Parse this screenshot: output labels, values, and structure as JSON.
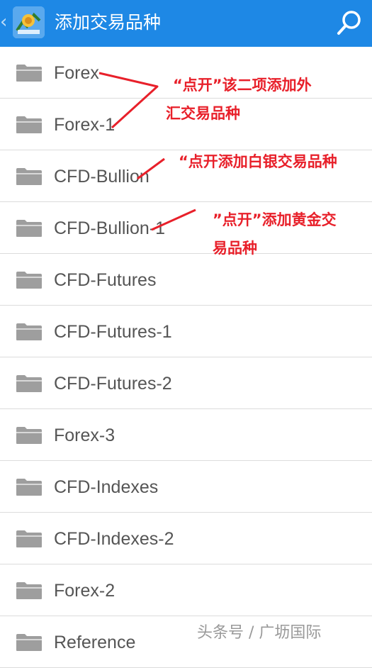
{
  "header": {
    "title": "添加交易品种",
    "back_icon": "chevron-left-icon",
    "app_icon": "metatrader-logo-icon",
    "search_icon": "search-icon",
    "background_color": "#1e88e5"
  },
  "list": {
    "folder_icon": "folder-icon",
    "items": [
      {
        "label": "Forex"
      },
      {
        "label": "Forex-1"
      },
      {
        "label": "CFD-Bullion"
      },
      {
        "label": "CFD-Bullion-1"
      },
      {
        "label": "CFD-Futures"
      },
      {
        "label": "CFD-Futures-1"
      },
      {
        "label": "CFD-Futures-2"
      },
      {
        "label": "Forex-3"
      },
      {
        "label": "CFD-Indexes"
      },
      {
        "label": "CFD-Indexes-2"
      },
      {
        "label": "Forex-2"
      },
      {
        "label": "Reference"
      }
    ]
  },
  "annotations": {
    "forex": [
      "“点开”该二项添加外",
      "汇交易品种"
    ],
    "silver": "“点开添加白银交易品种",
    "gold": [
      "”点开”添加黄金交",
      "易品种"
    ],
    "color": "#e8202a"
  },
  "watermark": "头条号 / 广坜国际"
}
